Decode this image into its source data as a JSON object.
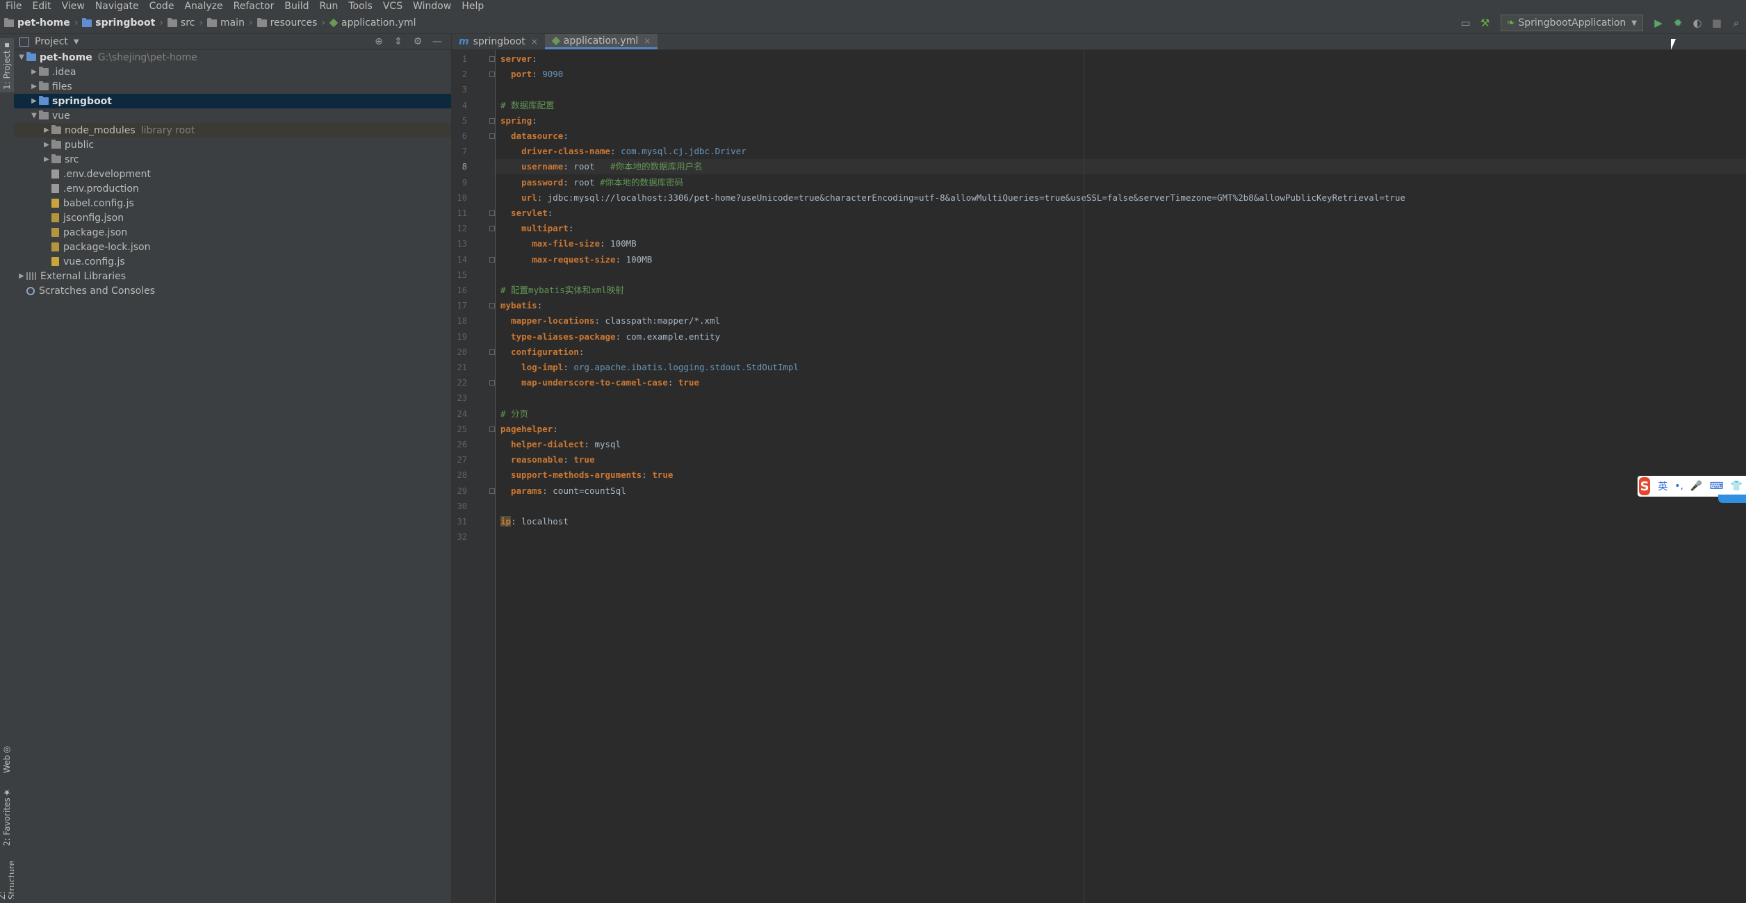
{
  "menu": [
    "File",
    "Edit",
    "View",
    "Navigate",
    "Code",
    "Analyze",
    "Refactor",
    "Build",
    "Run",
    "Tools",
    "VCS",
    "Window",
    "Help"
  ],
  "breadcrumb": [
    "pet-home",
    "springboot",
    "src",
    "main",
    "resources",
    "application.yml"
  ],
  "run_config": "SpringbootApplication",
  "left_strip": {
    "project": "1: Project",
    "web": "Web",
    "favorites": "2: Favorites",
    "structure": "Z: Structure"
  },
  "project_panel": {
    "title": "Project",
    "tree": [
      {
        "label": "pet-home",
        "hint": "G:\\shejing\\pet-home",
        "level": 0,
        "type": "root",
        "expanded": true
      },
      {
        "label": ".idea",
        "level": 1,
        "type": "folder"
      },
      {
        "label": "files",
        "level": 1,
        "type": "folder"
      },
      {
        "label": "springboot",
        "level": 1,
        "type": "folder-module",
        "selected": true
      },
      {
        "label": "vue",
        "level": 1,
        "type": "folder",
        "expanded": true
      },
      {
        "label": "node_modules",
        "hint": "library root",
        "level": 2,
        "type": "folder",
        "library": true
      },
      {
        "label": "public",
        "level": 2,
        "type": "folder"
      },
      {
        "label": "src",
        "level": 2,
        "type": "folder"
      },
      {
        "label": ".env.development",
        "level": 2,
        "type": "env"
      },
      {
        "label": ".env.production",
        "level": 2,
        "type": "env"
      },
      {
        "label": "babel.config.js",
        "level": 2,
        "type": "js"
      },
      {
        "label": "jsconfig.json",
        "level": 2,
        "type": "json"
      },
      {
        "label": "package.json",
        "level": 2,
        "type": "json"
      },
      {
        "label": "package-lock.json",
        "level": 2,
        "type": "json"
      },
      {
        "label": "vue.config.js",
        "level": 2,
        "type": "js"
      },
      {
        "label": "External Libraries",
        "level": 0,
        "type": "lib"
      },
      {
        "label": "Scratches and Consoles",
        "level": 0,
        "type": "scratch"
      }
    ]
  },
  "tabs": [
    {
      "label": "springboot",
      "active": false,
      "icon": "m"
    },
    {
      "label": "application.yml",
      "active": true,
      "icon": "yml"
    }
  ],
  "editor": {
    "current_line": 8,
    "lines": [
      [
        {
          "t": "server",
          "c": "key"
        },
        {
          "t": ":",
          "c": "val"
        }
      ],
      [
        {
          "t": "  port",
          "c": "key"
        },
        {
          "t": ": ",
          "c": "val"
        },
        {
          "t": "9090",
          "c": "num"
        }
      ],
      [],
      [
        {
          "t": "# 数据库配置",
          "c": "comment"
        }
      ],
      [
        {
          "t": "spring",
          "c": "key"
        },
        {
          "t": ":",
          "c": "val"
        }
      ],
      [
        {
          "t": "  datasource",
          "c": "key"
        },
        {
          "t": ":",
          "c": "val"
        }
      ],
      [
        {
          "t": "    driver-class-name",
          "c": "key"
        },
        {
          "t": ": ",
          "c": "val"
        },
        {
          "t": "com.mysql.cj.jdbc.Driver",
          "c": "num"
        }
      ],
      [
        {
          "t": "    username",
          "c": "key"
        },
        {
          "t": ": root   ",
          "c": "val"
        },
        {
          "t": "#你本地的数据库用户名",
          "c": "comment"
        }
      ],
      [
        {
          "t": "    password",
          "c": "key"
        },
        {
          "t": ": root ",
          "c": "val"
        },
        {
          "t": "#你本地的数据库密码",
          "c": "comment"
        }
      ],
      [
        {
          "t": "    url",
          "c": "key"
        },
        {
          "t": ": jdbc:mysql://localhost:3306/pet-home?useUnicode=true&characterEncoding=utf-8&allowMultiQueries=true&useSSL=false&serverTimezone=GMT%2b8&allowPublicKeyRetrieval=true",
          "c": "val"
        }
      ],
      [
        {
          "t": "  servlet",
          "c": "key"
        },
        {
          "t": ":",
          "c": "val"
        }
      ],
      [
        {
          "t": "    multipart",
          "c": "key"
        },
        {
          "t": ":",
          "c": "val"
        }
      ],
      [
        {
          "t": "      max-file-size",
          "c": "key"
        },
        {
          "t": ": 100MB",
          "c": "val"
        }
      ],
      [
        {
          "t": "      max-request-size",
          "c": "key"
        },
        {
          "t": ": 100MB",
          "c": "val"
        }
      ],
      [],
      [
        {
          "t": "# 配置mybatis实体和xml映射",
          "c": "comment"
        }
      ],
      [
        {
          "t": "mybatis",
          "c": "key"
        },
        {
          "t": ":",
          "c": "val"
        }
      ],
      [
        {
          "t": "  mapper-locations",
          "c": "key"
        },
        {
          "t": ": classpath:mapper/*.xml",
          "c": "val"
        }
      ],
      [
        {
          "t": "  type-aliases-package",
          "c": "key"
        },
        {
          "t": ": com.example.entity",
          "c": "val"
        }
      ],
      [
        {
          "t": "  configuration",
          "c": "key"
        },
        {
          "t": ":",
          "c": "val"
        }
      ],
      [
        {
          "t": "    log-impl",
          "c": "key"
        },
        {
          "t": ": ",
          "c": "val"
        },
        {
          "t": "org.apache.ibatis.logging.stdout.StdOutImpl",
          "c": "num"
        }
      ],
      [
        {
          "t": "    map-underscore-to-camel-case",
          "c": "key"
        },
        {
          "t": ": ",
          "c": "val"
        },
        {
          "t": "true",
          "c": "kw"
        }
      ],
      [],
      [
        {
          "t": "# 分页",
          "c": "comment"
        }
      ],
      [
        {
          "t": "pagehelper",
          "c": "key"
        },
        {
          "t": ":",
          "c": "val"
        }
      ],
      [
        {
          "t": "  helper-dialect",
          "c": "key"
        },
        {
          "t": ": mysql",
          "c": "val"
        }
      ],
      [
        {
          "t": "  reasonable",
          "c": "key"
        },
        {
          "t": ": ",
          "c": "val"
        },
        {
          "t": "true",
          "c": "kw"
        }
      ],
      [
        {
          "t": "  support-methods-arguments",
          "c": "key"
        },
        {
          "t": ": ",
          "c": "val"
        },
        {
          "t": "true",
          "c": "kw"
        }
      ],
      [
        {
          "t": "  params",
          "c": "key"
        },
        {
          "t": ": count=countSql",
          "c": "val"
        }
      ],
      [],
      [
        {
          "t": "ip",
          "c": "ipkey"
        },
        {
          "t": ": localhost",
          "c": "val"
        }
      ],
      []
    ]
  },
  "ime": {
    "logo": "S",
    "items": [
      "英",
      "•,",
      "🎤",
      "⌨",
      "👕"
    ]
  },
  "colors": {
    "accent": "#4a88c7",
    "selection": "#0d293e",
    "keyword": "#cc7832",
    "comment": "#629755"
  }
}
